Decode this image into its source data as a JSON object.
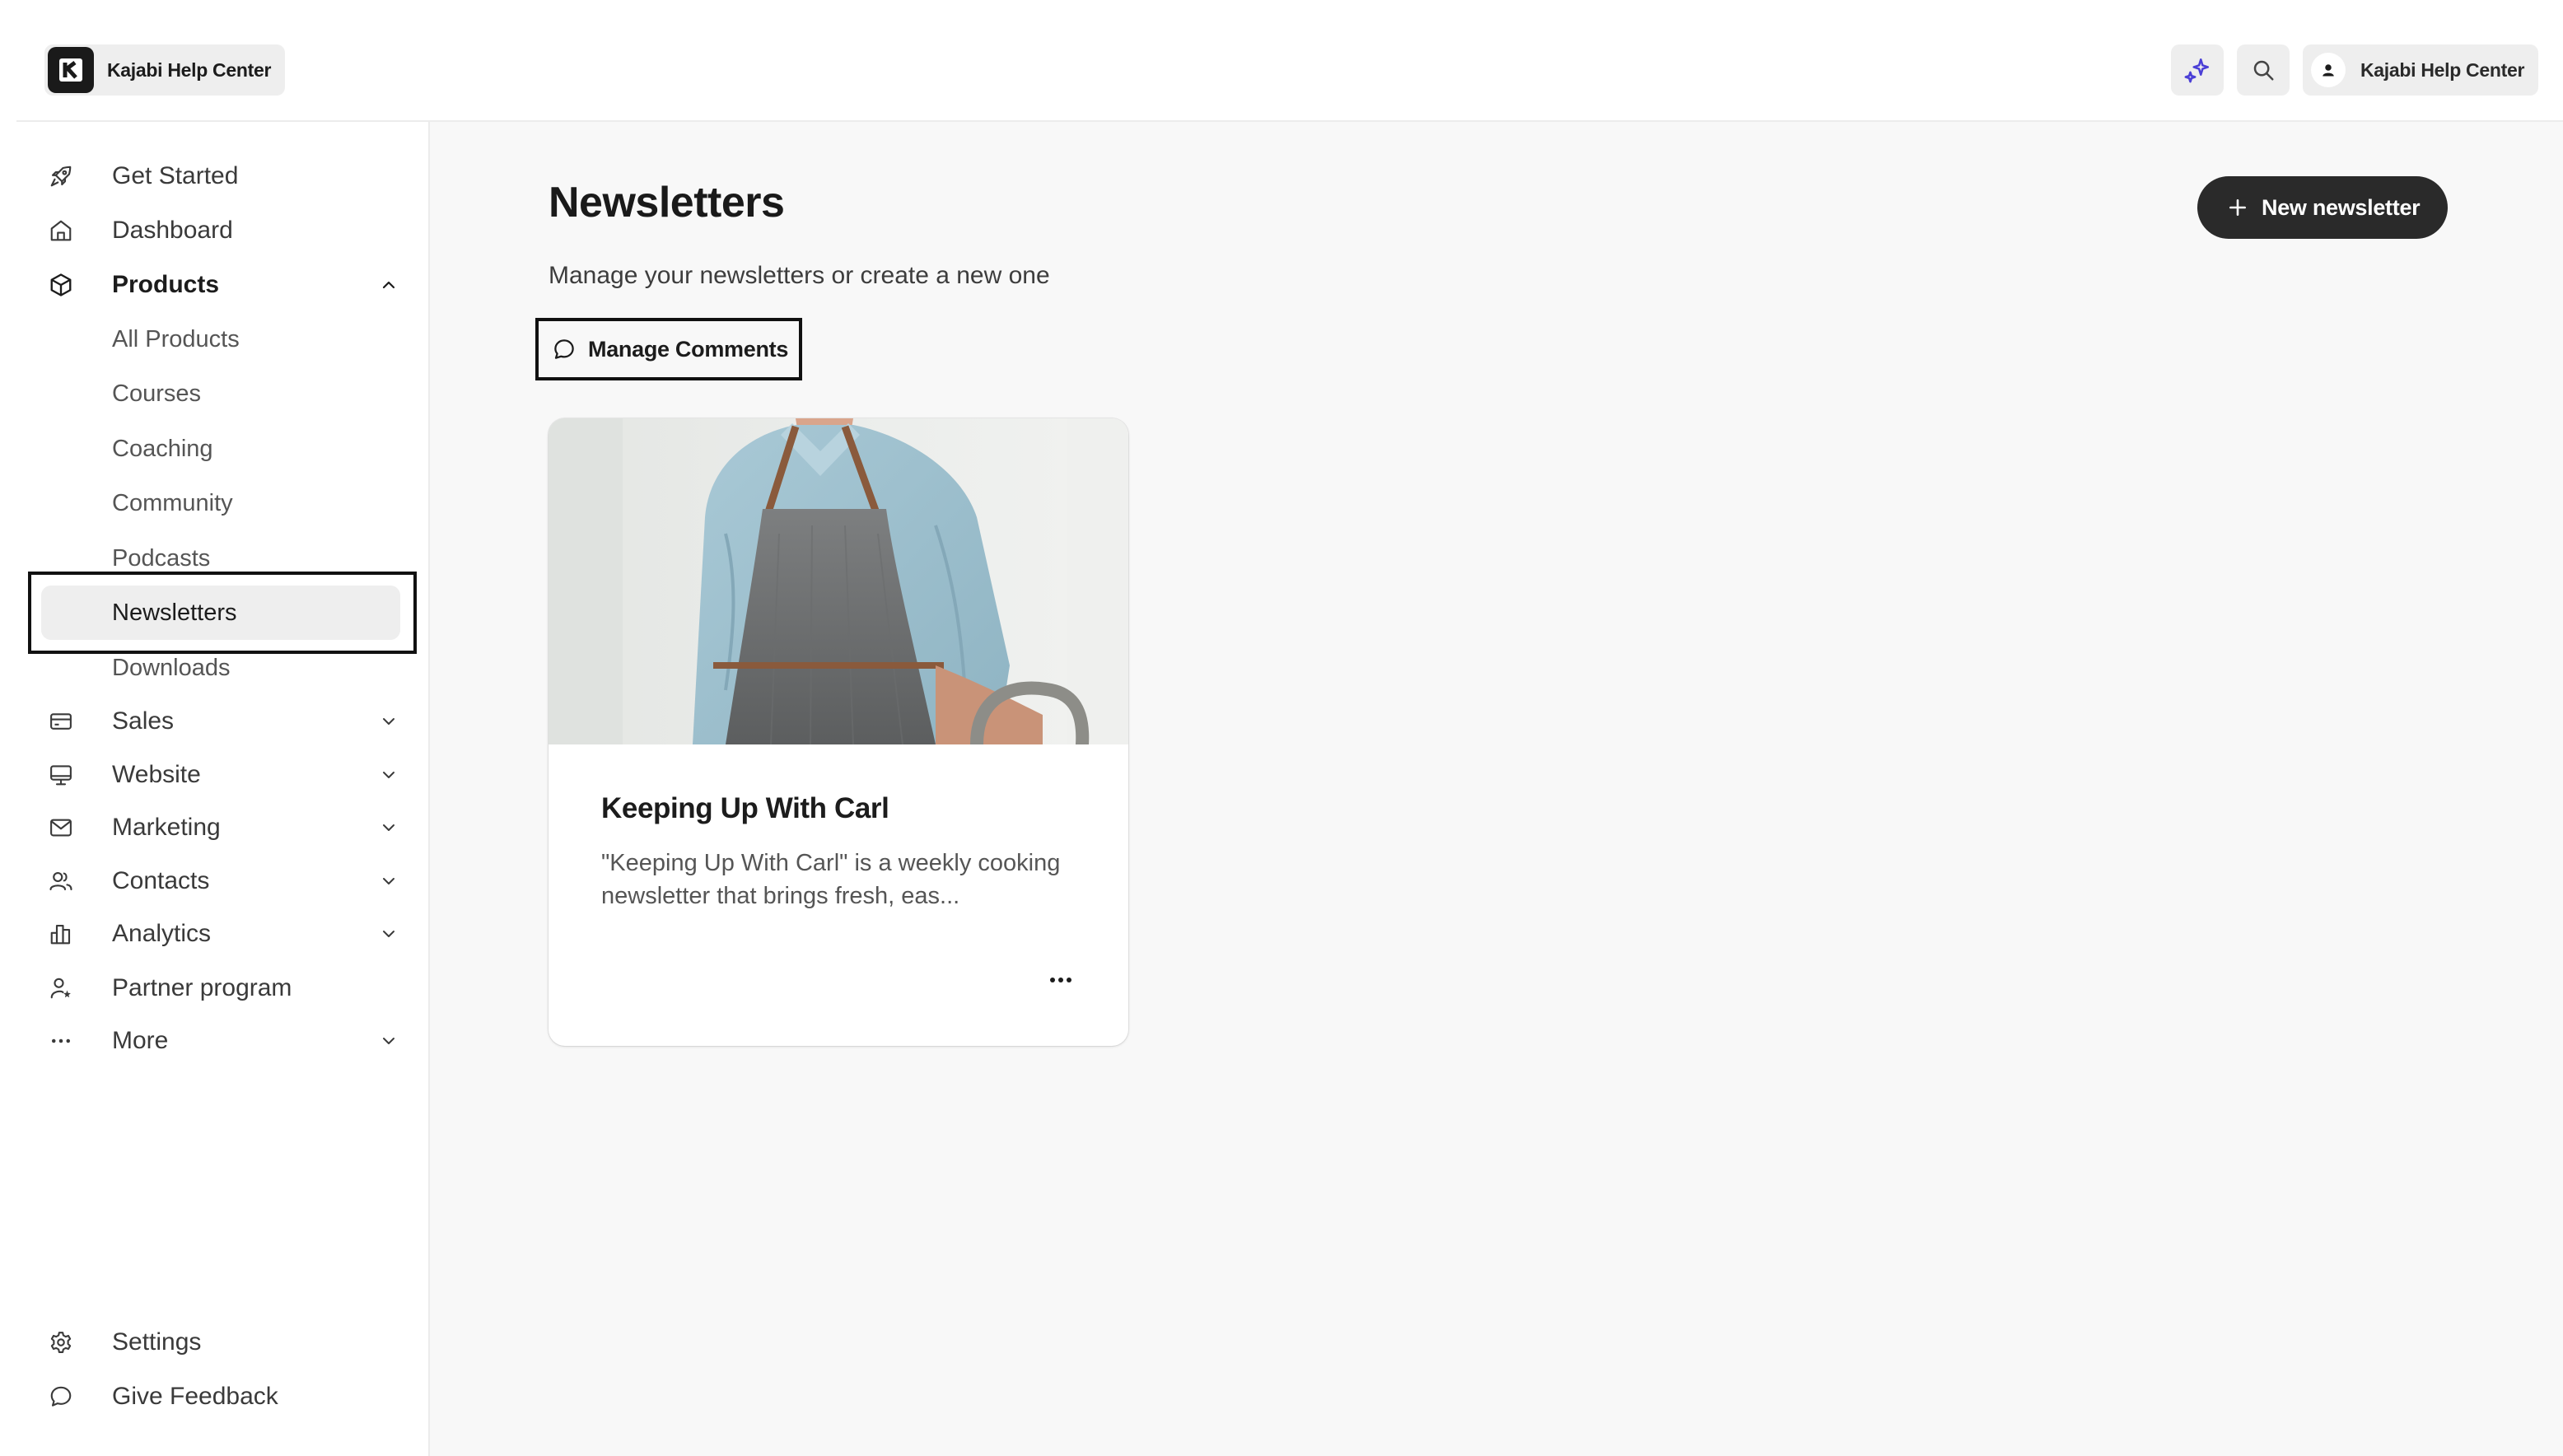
{
  "header": {
    "site_name": "Kajabi Help Center",
    "account_name": "Kajabi Help Center",
    "ai_button_icon": "sparkle-icon",
    "search_button_icon": "search-icon",
    "accent_color": "#4b3fd6"
  },
  "sidebar": {
    "items": [
      {
        "label": "Get Started",
        "icon": "rocket-icon"
      },
      {
        "label": "Dashboard",
        "icon": "home-icon"
      },
      {
        "label": "Products",
        "icon": "box-icon",
        "expanded": true
      },
      {
        "label": "Sales",
        "icon": "credit-card-icon"
      },
      {
        "label": "Website",
        "icon": "monitor-icon"
      },
      {
        "label": "Marketing",
        "icon": "mail-icon"
      },
      {
        "label": "Contacts",
        "icon": "users-icon"
      },
      {
        "label": "Analytics",
        "icon": "bar-chart-icon"
      },
      {
        "label": "Partner program",
        "icon": "partner-icon"
      },
      {
        "label": "More",
        "icon": "more-icon"
      }
    ],
    "products_sub": [
      {
        "label": "All Products"
      },
      {
        "label": "Courses"
      },
      {
        "label": "Coaching"
      },
      {
        "label": "Community"
      },
      {
        "label": "Podcasts"
      },
      {
        "label": "Newsletters",
        "active": true
      },
      {
        "label": "Downloads"
      }
    ],
    "bottom": [
      {
        "label": "Settings",
        "icon": "gear-icon"
      },
      {
        "label": "Give Feedback",
        "icon": "chat-bubble-icon"
      }
    ]
  },
  "main": {
    "title": "Newsletters",
    "subtitle": "Manage your newsletters or create a new one",
    "new_button_label": "New newsletter",
    "manage_comments_label": "Manage Comments",
    "newsletters": [
      {
        "title": "Keeping Up With Carl",
        "description": "\"Keeping Up With Carl\" is a weekly cooking newsletter that brings fresh, eas...",
        "image": "man-in-apron-photo"
      }
    ]
  }
}
